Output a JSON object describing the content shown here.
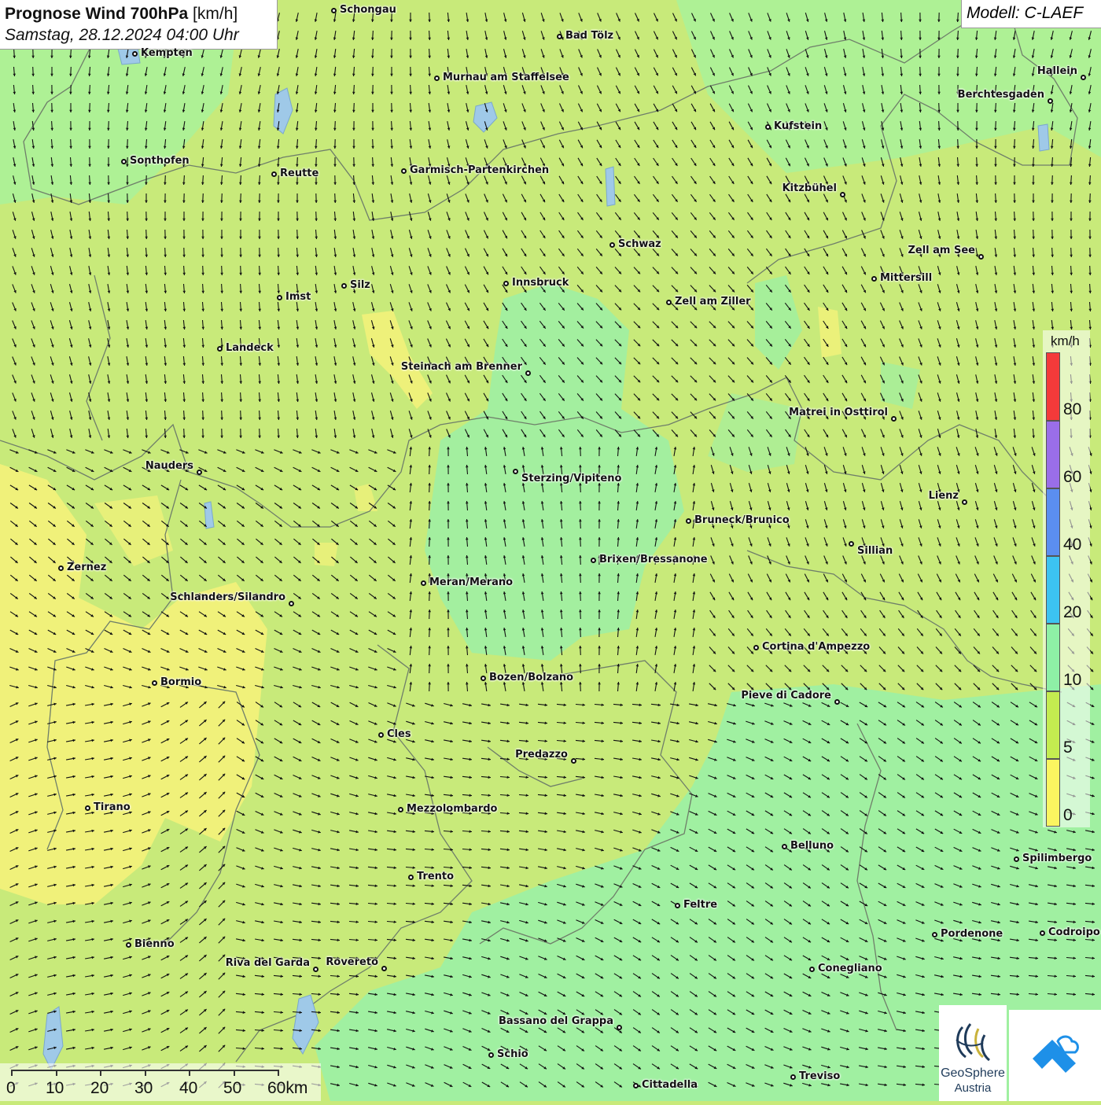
{
  "header": {
    "title_bold": "Prognose Wind 700hPa",
    "title_unit": "[km/h]",
    "datetime": "Samstag, 28.12.2024 04:00 Uhr"
  },
  "model": "Modell: C-LAEF",
  "legend": {
    "unit": "km/h",
    "labels": [
      "80",
      "60",
      "40",
      "20",
      "10",
      "5",
      "0"
    ],
    "colors": {
      "c80": "#f43a3a",
      "c60": "#9a6ee8",
      "c40": "#5b8ef0",
      "c20": "#3cc3f2",
      "c10": "#8ef0a6",
      "c5": "#c4ec50",
      "c0": "#fbf560"
    }
  },
  "scale": {
    "labels": [
      "0",
      "10",
      "20",
      "30",
      "40",
      "50",
      "60km"
    ]
  },
  "logos": {
    "geosphere_line1": "GeoSphere",
    "geosphere_line2": "Austria",
    "geosphere_icon": "geosphere-swirl-icon",
    "partner_icon": "mountain-cloud-icon"
  },
  "cities": [
    {
      "name": "Schongau"
    },
    {
      "name": "Bad Tölz"
    },
    {
      "name": "Kempten"
    },
    {
      "name": "Murnau am Staffelsee"
    },
    {
      "name": "Hallein"
    },
    {
      "name": "Berchtesgaden"
    },
    {
      "name": "Kufstein"
    },
    {
      "name": "Sonthofen"
    },
    {
      "name": "Reutte"
    },
    {
      "name": "Garmisch-Partenkirchen"
    },
    {
      "name": "Kitzbühel"
    },
    {
      "name": "Schwaz"
    },
    {
      "name": "Zell am See"
    },
    {
      "name": "Mittersill"
    },
    {
      "name": "Innsbruck"
    },
    {
      "name": "Silz"
    },
    {
      "name": "Imst"
    },
    {
      "name": "Zell am Ziller"
    },
    {
      "name": "Landeck"
    },
    {
      "name": "Steinach am Brenner"
    },
    {
      "name": "Matrei in Osttirol"
    },
    {
      "name": "Nauders"
    },
    {
      "name": "Sterzing/Vipiteno"
    },
    {
      "name": "Lienz"
    },
    {
      "name": "Bruneck/Brunico"
    },
    {
      "name": "Sillian"
    },
    {
      "name": "Brixen/Bressanone"
    },
    {
      "name": "Zernez"
    },
    {
      "name": "Meran/Merano"
    },
    {
      "name": "Schlanders/Silandro"
    },
    {
      "name": "Cortina d'Ampezzo"
    },
    {
      "name": "Bozen/Bolzano"
    },
    {
      "name": "Bormio"
    },
    {
      "name": "Pieve di Cadore"
    },
    {
      "name": "Cles"
    },
    {
      "name": "Predazzo"
    },
    {
      "name": "Tirano"
    },
    {
      "name": "Mezzolombardo"
    },
    {
      "name": "Belluno"
    },
    {
      "name": "Spilimbergo"
    },
    {
      "name": "Trento"
    },
    {
      "name": "Feltre"
    },
    {
      "name": "Pordenone"
    },
    {
      "name": "Codroipo"
    },
    {
      "name": "Bienno"
    },
    {
      "name": "Riva del Garda"
    },
    {
      "name": "Rovereto"
    },
    {
      "name": "Conegliano"
    },
    {
      "name": "Bassano del Grappa"
    },
    {
      "name": "Schio"
    },
    {
      "name": "Treviso"
    },
    {
      "name": "Cittadella"
    }
  ]
}
